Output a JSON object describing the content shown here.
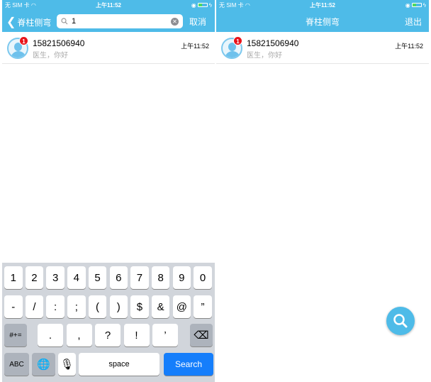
{
  "status": {
    "carrier": "无 SIM 卡",
    "time": "上午11:52"
  },
  "left": {
    "back_label": "脊柱侧弯",
    "search_value": "1",
    "cancel_label": "取消"
  },
  "right": {
    "title": "脊柱侧弯",
    "exit_label": "退出"
  },
  "conversation": {
    "name": "15821506940",
    "message": "医生，你好",
    "time": "上午11:52",
    "unread": "1"
  },
  "keyboard": {
    "row1": [
      "1",
      "2",
      "3",
      "4",
      "5",
      "6",
      "7",
      "8",
      "9",
      "0"
    ],
    "row2": [
      "-",
      "/",
      ":",
      ";",
      "(",
      ")",
      "$",
      "&",
      "@",
      "”"
    ],
    "row3": [
      ".",
      ",",
      "?",
      "!",
      "’"
    ],
    "symbols": "#+=",
    "abc": "ABC",
    "space": "space",
    "search": "Search"
  },
  "colors": {
    "nav": "#4ebbe8",
    "search_key": "#157efb",
    "badge": "#e8131a"
  }
}
